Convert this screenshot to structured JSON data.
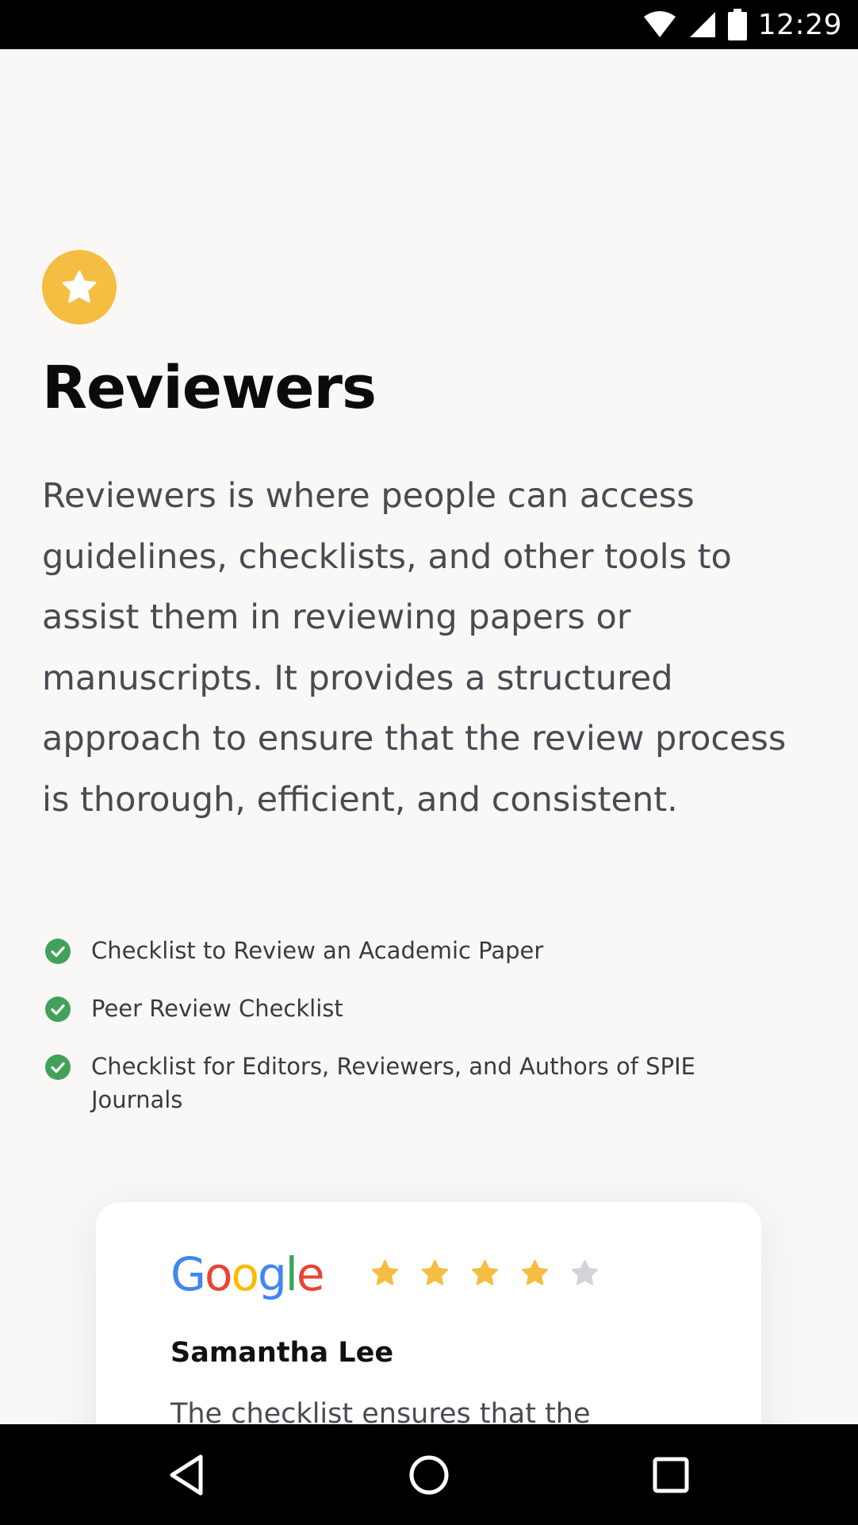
{
  "status_bar": {
    "time": "12:29",
    "icons": [
      "wifi-icon",
      "cellular-signal-icon",
      "battery-icon"
    ]
  },
  "section": {
    "badge_icon": "star-icon",
    "badge_color": "#f5bd41",
    "title": "Reviewers",
    "description": "Reviewers is where people can access guidelines, checklists, and other tools to assist them in reviewing papers or manuscripts. It provides a structured approach to ensure that the review process is thorough, efficient, and consistent.",
    "checklist_icon": "check-circle-icon",
    "checklist_color": "#43a05a",
    "checklist": [
      "Checklist to Review an Academic Paper",
      "Peer Review Checklist",
      "Checklist for Editors, Reviewers, and Authors of SPIE Journals"
    ]
  },
  "review_card": {
    "brand_logo": "Google",
    "rating": 4,
    "rating_max": 5,
    "star_filled_color": "#f5bd41",
    "star_empty_color": "#d3d3d8",
    "reviewer_name": "Samantha Lee",
    "review_text": "The checklist ensures that the"
  },
  "nav_bar": {
    "buttons": [
      "back-icon",
      "home-icon",
      "recents-icon"
    ]
  }
}
